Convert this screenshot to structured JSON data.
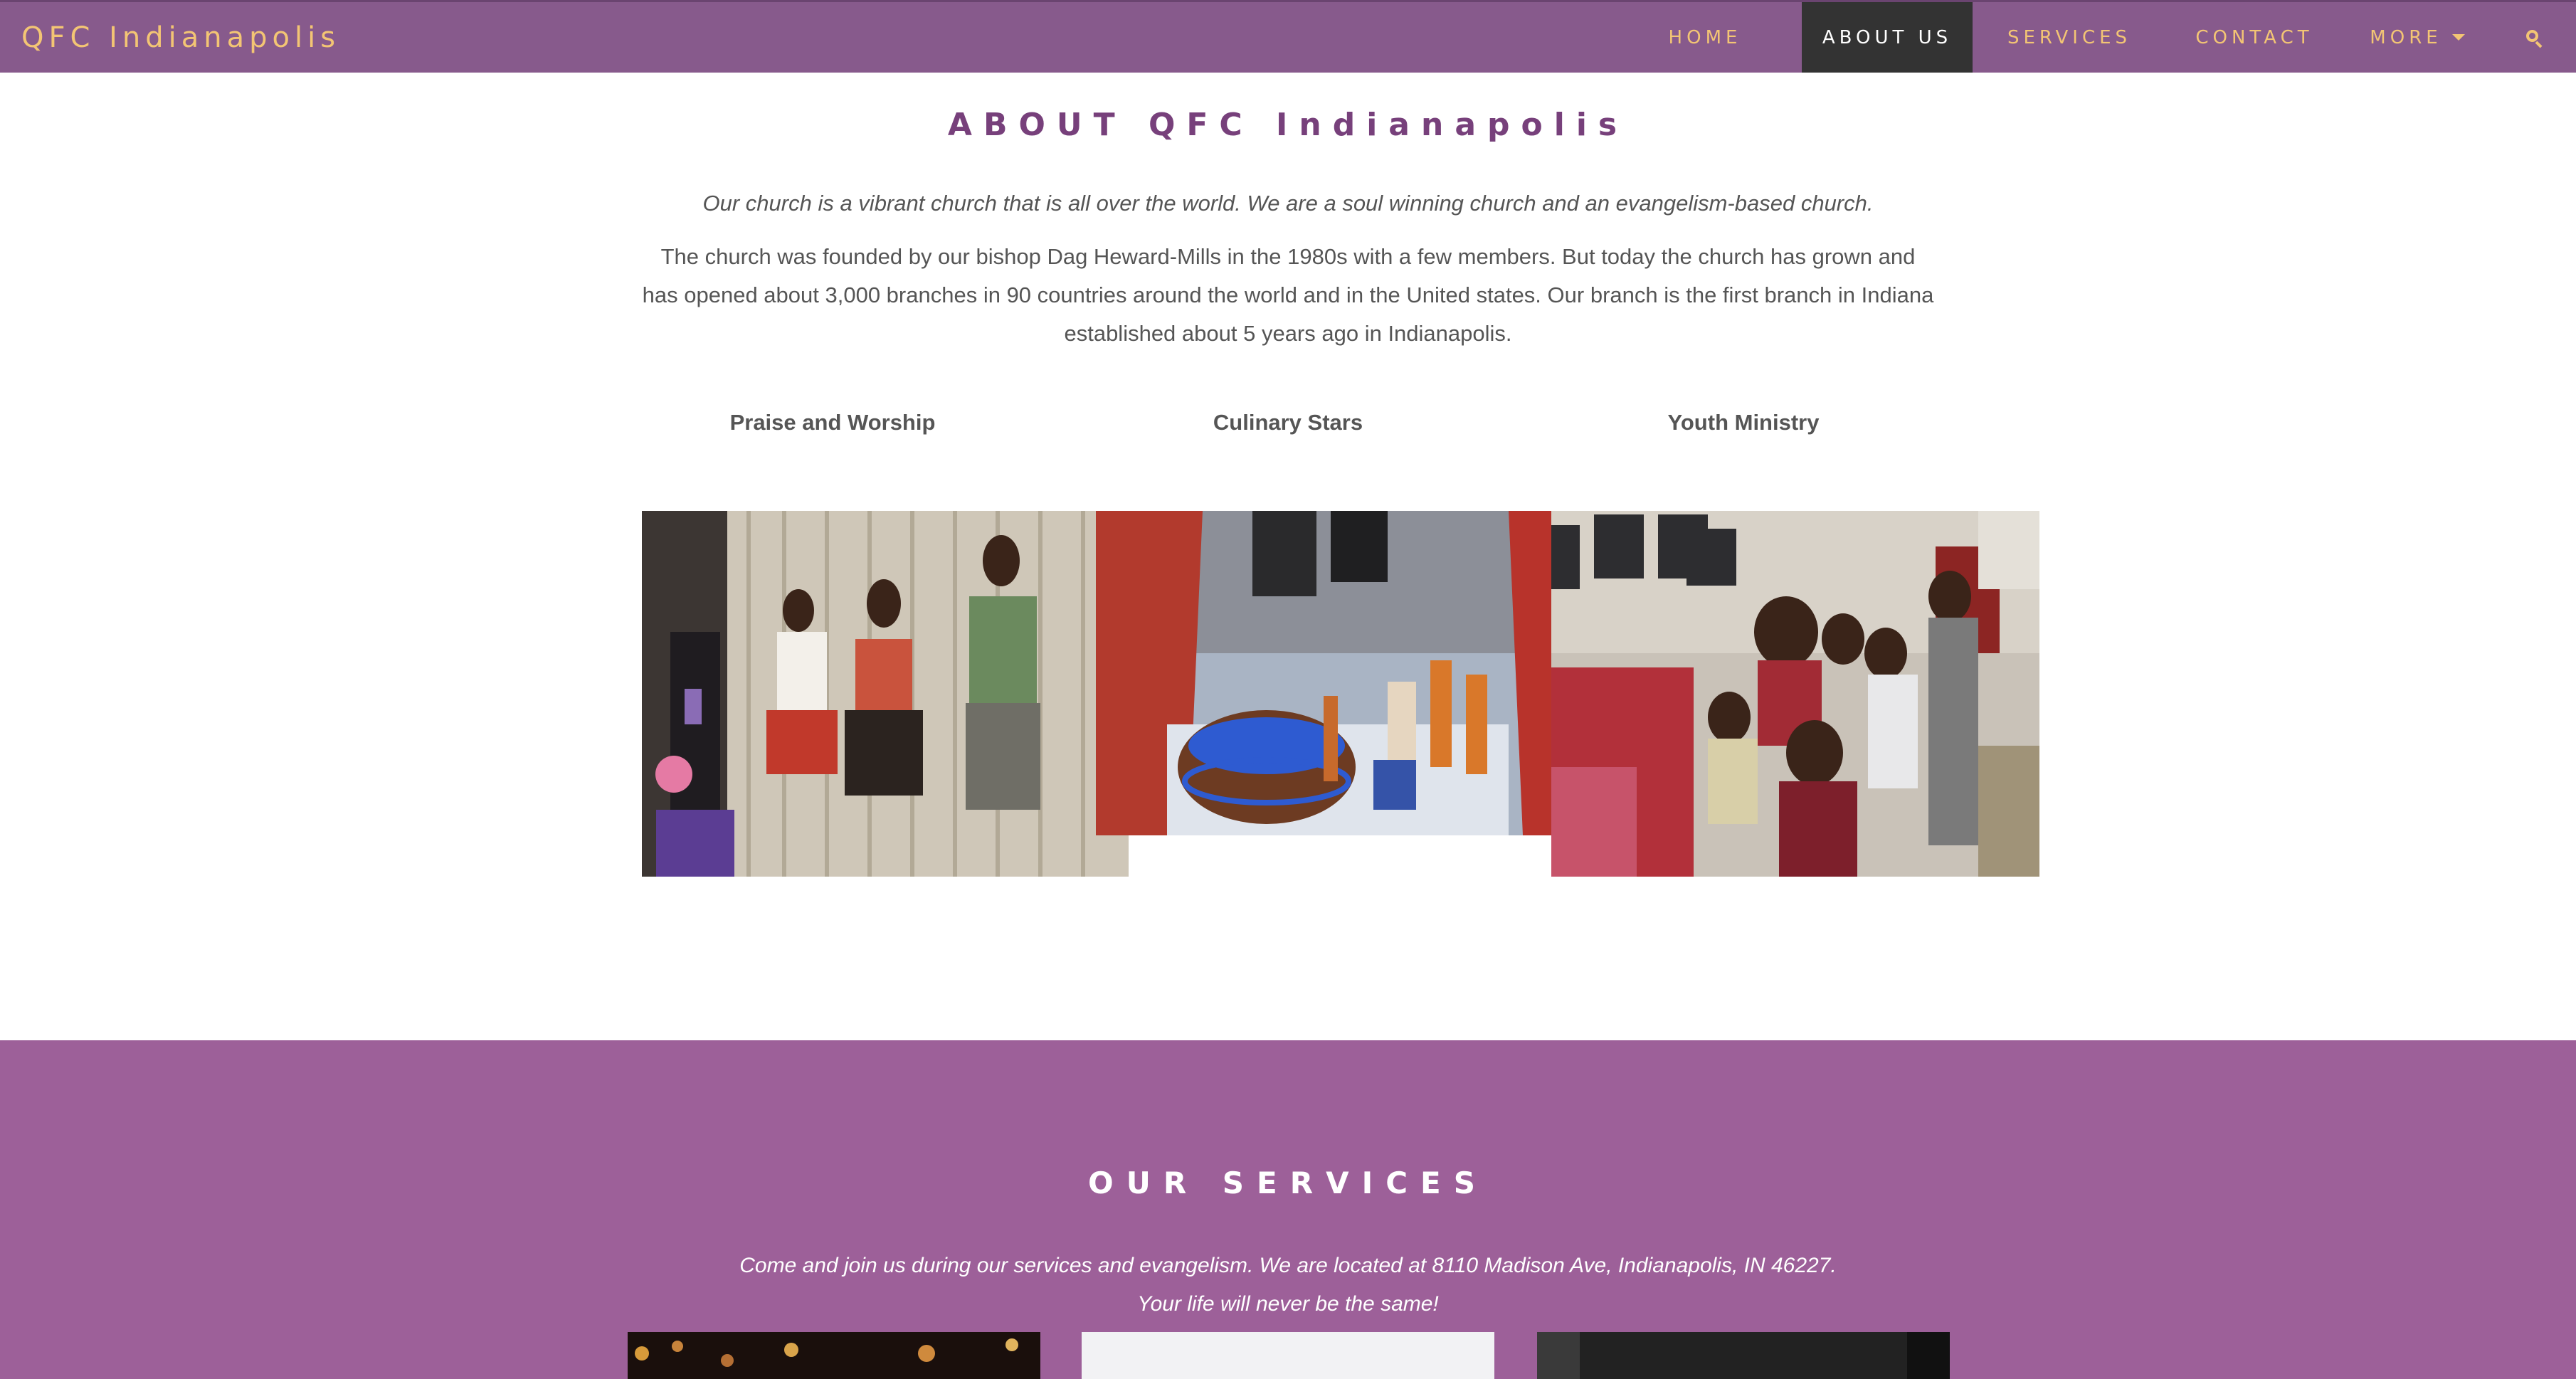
{
  "nav": {
    "brand": "QFC Indianapolis",
    "items": [
      {
        "label": "HOME"
      },
      {
        "label": "ABOUT US"
      },
      {
        "label": "SERVICES"
      },
      {
        "label": "CONTACT"
      },
      {
        "label": "MORE"
      }
    ],
    "active_item": "ABOUT US",
    "search_icon": "search-icon"
  },
  "about": {
    "title": "ABOUT QFC Indianapolis",
    "intro": "Our church is a vibrant church that is all over the world. We are a soul winning church and an evangelism-based church.",
    "body": "The church was founded by our bishop Dag Heward-Mills in the 1980s with a few members. But today the church has grown and has opened about 3,000 branches in 90 countries around the world and in the United states. Our branch is the first branch in Indiana established about 5 years ago in Indianapolis.",
    "ministries": [
      {
        "title": "Praise and Worship"
      },
      {
        "title": "Culinary Stars"
      },
      {
        "title": "Youth Ministry"
      }
    ]
  },
  "services": {
    "title": "OUR SERVICES",
    "line1": "Come and join us during our services and evangelism. We are located at 8110 Madison Ave, Indianapolis, IN 46227.",
    "line2": "Your life will never be the same!"
  },
  "colors": {
    "nav_bg": "#875a8c",
    "nav_text": "#f3c574",
    "nav_active_bg": "#333333",
    "heading_purple": "#77407b",
    "services_bg": "#9d6099"
  }
}
